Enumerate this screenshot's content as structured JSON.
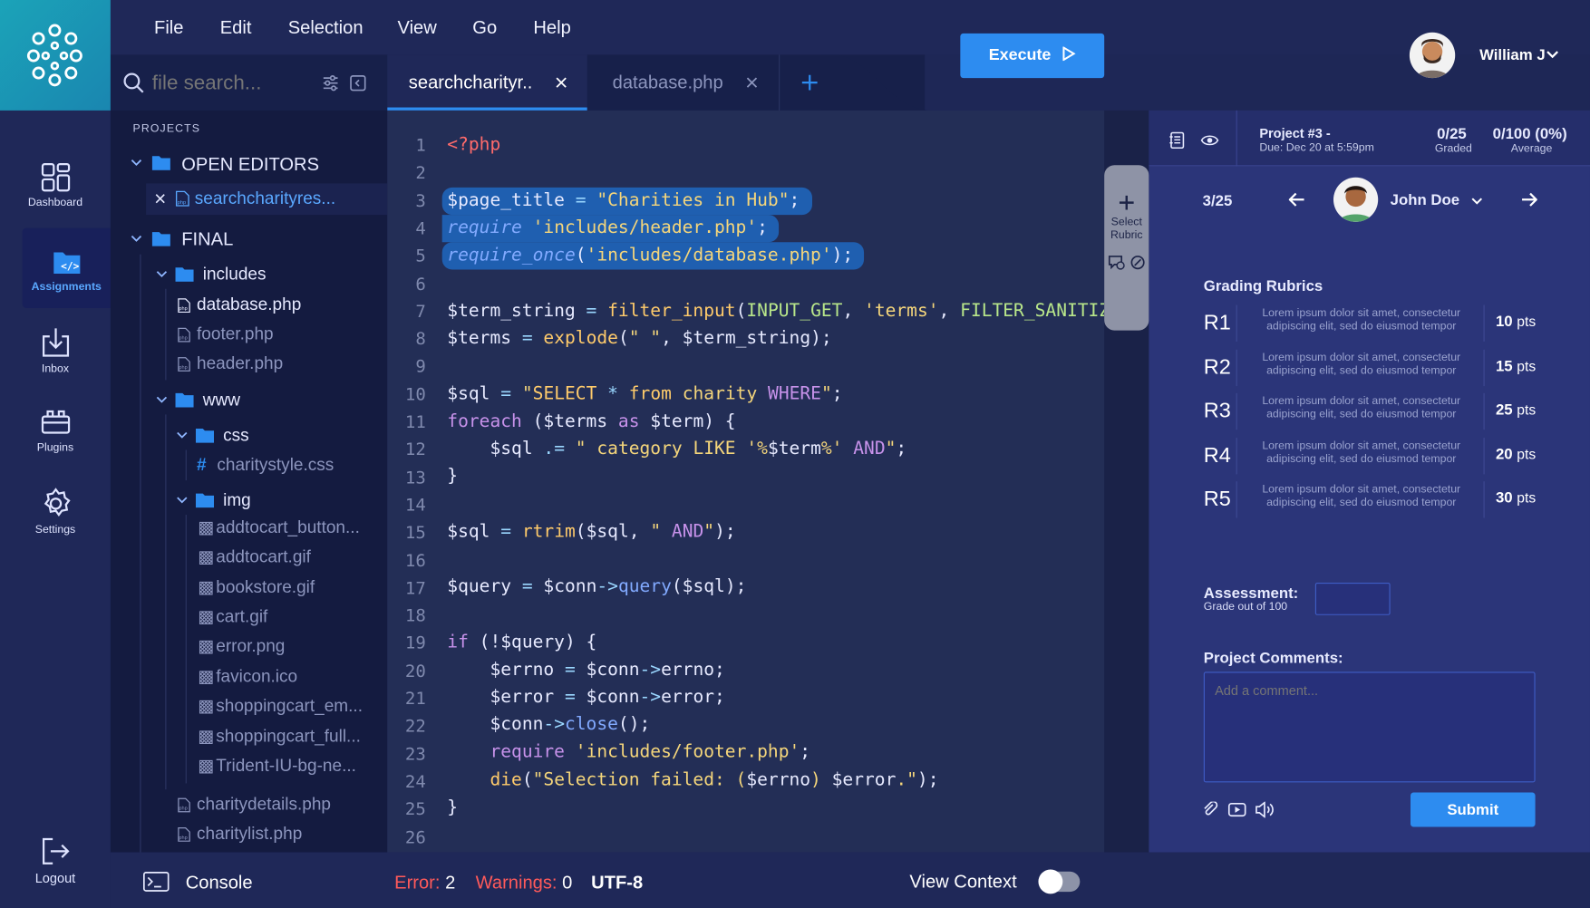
{
  "menu": [
    "File",
    "Edit",
    "Selection",
    "View",
    "Go",
    "Help"
  ],
  "execute_label": "Execute",
  "user_name": "William J",
  "rail": [
    {
      "label": "Dashboard",
      "icon": "dashboard-icon"
    },
    {
      "label": "Assignments",
      "icon": "assignments-icon"
    },
    {
      "label": "Inbox",
      "icon": "inbox-icon"
    },
    {
      "label": "Plugins",
      "icon": "plugins-icon"
    },
    {
      "label": "Settings",
      "icon": "gear-icon"
    }
  ],
  "logout_label": "Logout",
  "search_placeholder": "file search...",
  "tabs": [
    {
      "label": "searchcharityr.."
    },
    {
      "label": "database.php"
    }
  ],
  "explorer": {
    "header": "PROJECTS",
    "open_editors": "OPEN EDITORS",
    "open_file": "searchcharityres...",
    "final": "FINAL",
    "includes": "includes",
    "includes_files": [
      "database.php",
      "footer.php",
      "header.php"
    ],
    "www": "www",
    "css": "css",
    "css_files": [
      "charitystyle.css"
    ],
    "img": "img",
    "img_files": [
      "addtocart_button...",
      "addtocart.gif",
      "bookstore.gif",
      "cart.gif",
      "error.png",
      "favicon.ico",
      "shoppingcart_em...",
      "shoppingcart_full...",
      "Trident-IU-bg-ne..."
    ],
    "root_files": [
      "charitydetails.php",
      "charitylist.php"
    ]
  },
  "line_numbers": [
    "1",
    "2",
    "3",
    "4",
    "5",
    "6",
    "7",
    "8",
    "9",
    "10",
    "11",
    "12",
    "13",
    "14",
    "15",
    "16",
    "17",
    "18",
    "19",
    "20",
    "21",
    "22",
    "23",
    "24",
    "25",
    "26"
  ],
  "select_rubric_label": "Select Rubric",
  "grading": {
    "project_title": "Project #3 -",
    "due": "Due: Dec 20 at 5:59pm",
    "graded_value": "0/25",
    "graded_label": "Graded",
    "average_value": "0/100 (0%)",
    "average_label": "Average",
    "student_index": "3/25",
    "student_name": "John Doe",
    "rubrics_title": "Grading Rubrics",
    "rubrics": [
      {
        "id": "R1",
        "desc": "Lorem ipsum dolor sit amet, consectetur adipiscing elit, sed do eiusmod tempor",
        "pts": "10",
        "unit": "pts"
      },
      {
        "id": "R2",
        "desc": "Lorem ipsum dolor sit amet, consectetur adipiscing elit, sed do eiusmod tempor",
        "pts": "15",
        "unit": "pts"
      },
      {
        "id": "R3",
        "desc": "Lorem ipsum dolor sit amet, consectetur adipiscing elit, sed do eiusmod tempor",
        "pts": "25",
        "unit": "pts"
      },
      {
        "id": "R4",
        "desc": "Lorem ipsum dolor sit amet, consectetur adipiscing elit, sed do eiusmod tempor",
        "pts": "20",
        "unit": "pts"
      },
      {
        "id": "R5",
        "desc": "Lorem ipsum dolor sit amet, consectetur adipiscing elit, sed do eiusmod tempor",
        "pts": "30",
        "unit": "pts"
      }
    ],
    "assessment_label": "Assessment:",
    "assessment_sub": "Grade out of 100",
    "comments_label": "Project Comments:",
    "comment_placeholder": "Add a comment...",
    "submit_label": "Submit"
  },
  "status": {
    "console_label": "Console",
    "error_label": "Error:",
    "error_count": "2",
    "warnings_label": "Warnings:",
    "warnings_count": "0",
    "encoding": "UTF-8",
    "view_context_label": "View Context"
  },
  "colors": {
    "accent": "#2d8cf0",
    "error": "#ff5a5a",
    "bg": "#1e2756",
    "panel": "#2b3579"
  }
}
